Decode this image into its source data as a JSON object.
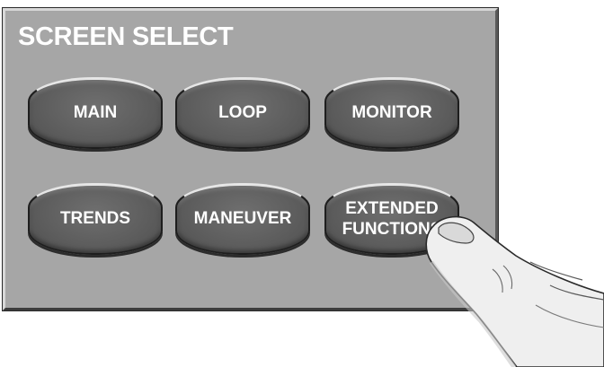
{
  "panel": {
    "title": "SCREEN SELECT"
  },
  "buttons": {
    "main": "MAIN",
    "loop": "LOOP",
    "monitor": "MONITOR",
    "trends": "TRENDS",
    "maneuver": "MANEUVER",
    "extended_line1": "EXTENDED",
    "extended_line2": "FUNCTIONS"
  },
  "colors": {
    "panel_bg": "#a6a6a6",
    "button_face": "#5e5e5e",
    "label_text": "#ffffff"
  },
  "icons": {
    "pointer": "pointing-finger-icon"
  }
}
